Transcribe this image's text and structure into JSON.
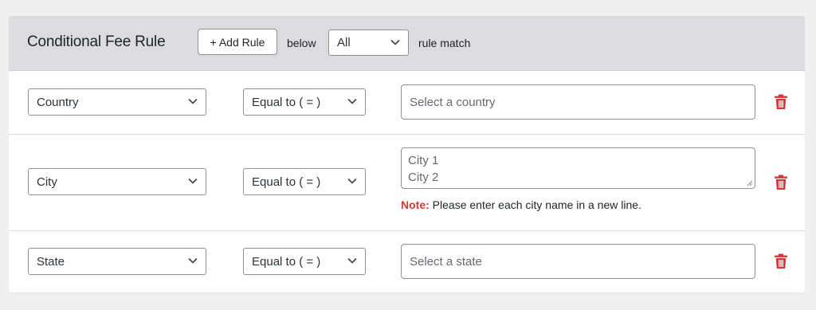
{
  "header": {
    "title": "Conditional Fee Rule",
    "add_rule_label": "+ Add Rule",
    "below_label": "below",
    "match_select_value": "All",
    "rule_match_label": "rule match"
  },
  "rules": [
    {
      "field": "Country",
      "operator": "Equal to ( = )",
      "input_placeholder": "Select a country"
    },
    {
      "field": "City",
      "operator": "Equal to ( = )",
      "textarea_lines": [
        "City 1",
        "City 2"
      ],
      "note_label": "Note:",
      "note_text": "Please enter each city name in a new line."
    },
    {
      "field": "State",
      "operator": "Equal to ( = )",
      "input_placeholder": "Select a state"
    }
  ],
  "icons": {
    "chevron": "chevron-down-icon",
    "delete": "trash-icon",
    "resize": "resize-handle-icon"
  },
  "colors": {
    "header_bg": "#dcdcde",
    "delete_icon": "#d63638",
    "note_label": "#d63638",
    "border": "#8c8f94"
  }
}
